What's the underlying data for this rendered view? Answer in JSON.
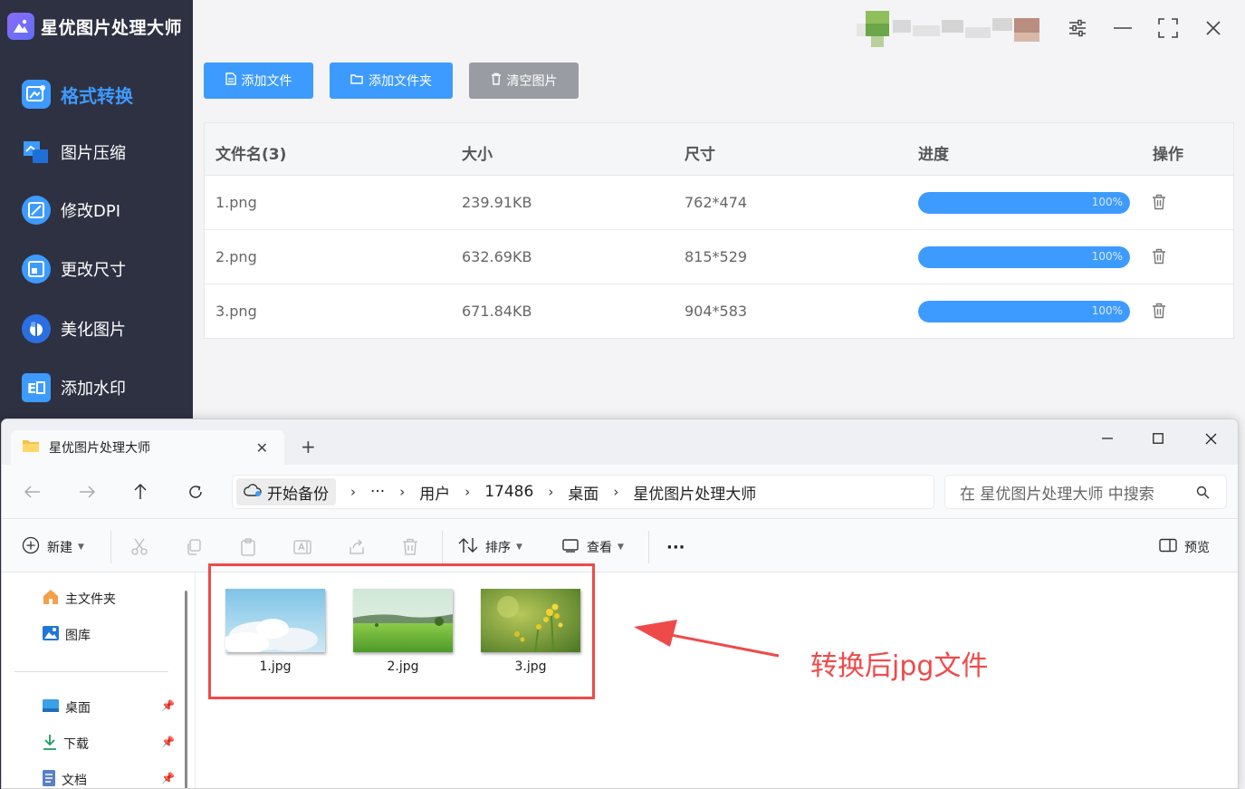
{
  "app": {
    "title": "星优图片处理大师",
    "nav": [
      {
        "label": "格式转换",
        "icon": "image-convert-icon",
        "active": true
      },
      {
        "label": "图片压缩",
        "icon": "image-compress-icon",
        "active": false
      },
      {
        "label": "修改DPI",
        "icon": "dpi-icon",
        "active": false
      },
      {
        "label": "更改尺寸",
        "icon": "resize-icon",
        "active": false
      },
      {
        "label": "美化图片",
        "icon": "beautify-icon",
        "active": false
      },
      {
        "label": "添加水印",
        "icon": "watermark-icon",
        "active": false
      }
    ],
    "toolbar": {
      "add_file": "添加文件",
      "add_folder": "添加文件夹",
      "clear": "清空图片"
    },
    "table": {
      "headers": {
        "name": "文件名(3)",
        "size": "大小",
        "dims": "尺寸",
        "progress": "进度",
        "action": "操作"
      },
      "rows": [
        {
          "name": "1.png",
          "size": "239.91KB",
          "dims": "762*474",
          "progress": 1.0,
          "progress_text": "100%"
        },
        {
          "name": "2.png",
          "size": "632.69KB",
          "dims": "815*529",
          "progress": 1.0,
          "progress_text": "100%"
        },
        {
          "name": "3.png",
          "size": "671.84KB",
          "dims": "904*583",
          "progress": 1.0,
          "progress_text": "100%"
        }
      ]
    },
    "colors": {
      "accent": "#3d9bff",
      "sidebar": "#2e3142",
      "clear_button": "#9a9ca3"
    }
  },
  "explorer": {
    "tab_title": "星优图片处理大师",
    "breadcrumb": {
      "home": "开始备份",
      "ellipsis": "···",
      "items": [
        "用户",
        "17486",
        "桌面",
        "星优图片处理大师"
      ]
    },
    "search_placeholder": "在 星优图片处理大师 中搜索",
    "commands": {
      "new": "新建",
      "sort": "排序",
      "view": "查看",
      "more": "···",
      "preview": "预览"
    },
    "nav": {
      "home": "主文件夹",
      "gallery": "图库",
      "desktop": "桌面",
      "downloads": "下载",
      "documents": "文档"
    },
    "files": [
      {
        "name": "1.jpg",
        "thumb": "sky-clouds"
      },
      {
        "name": "2.jpg",
        "thumb": "green-field"
      },
      {
        "name": "3.jpg",
        "thumb": "yellow-flowers"
      }
    ]
  },
  "annotation": {
    "text": "转换后jpg文件",
    "color": "#ef4a4a"
  }
}
